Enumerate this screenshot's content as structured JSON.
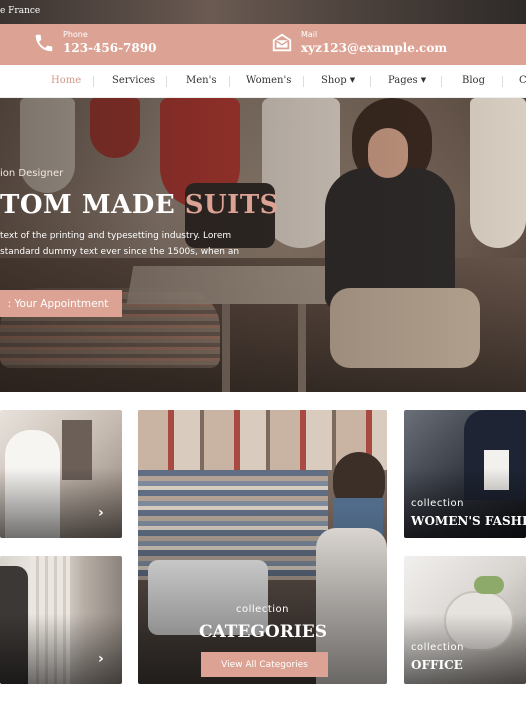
{
  "topbar": {
    "location": "e France"
  },
  "contact": {
    "phone": {
      "label": "Phone",
      "value": "123-456-7890",
      "icon": "phone-icon"
    },
    "mail": {
      "label": "Mail",
      "value": "xyz123@example.com",
      "icon": "mail-icon"
    }
  },
  "nav": {
    "items": [
      {
        "label": "Home",
        "active": true
      },
      {
        "label": "Services"
      },
      {
        "label": "Men's"
      },
      {
        "label": "Women's"
      },
      {
        "label": "Shop"
      },
      {
        "label": "Pages"
      },
      {
        "label": "Blog"
      },
      {
        "label": "C"
      }
    ]
  },
  "hero": {
    "subtitle": "ion Designer",
    "title_main": "TOM MADE ",
    "title_accent": "SUITS",
    "desc_line1": "text of the printing and typesetting industry. Lorem",
    "desc_line2": "standard dummy text ever since the 1500s, when an",
    "cta": ": Your Appointment"
  },
  "cards": {
    "left_top": {
      "icon": "chevron-right-icon"
    },
    "left_bottom": {
      "icon": "chevron-right-icon"
    },
    "center": {
      "tag": "collection",
      "title": "CATEGORIES",
      "button": "View All Categories"
    },
    "right_top": {
      "tag": "collection",
      "title": "WOMEN'S FASHIO"
    },
    "right_bottom": {
      "tag": "collection",
      "title": "OFFICE"
    }
  },
  "colors": {
    "accent": "#dca394",
    "nav_active": "#d4988a"
  }
}
